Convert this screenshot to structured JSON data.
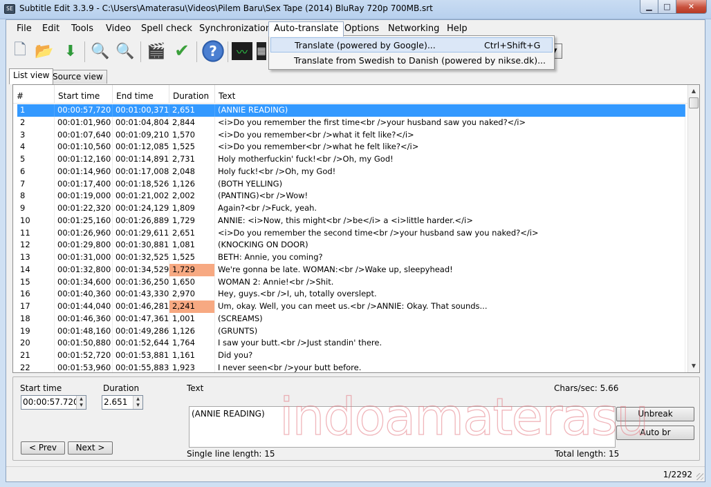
{
  "window": {
    "title": "Subtitle Edit 3.3.9 - C:\\Users\\Amaterasu\\Videos\\Pilem Baru\\Sex Tape (2014) BluRay 720p 700MB.srt",
    "app_icon": "SE",
    "minimize_glyph": "▁",
    "maximize_glyph": "□",
    "close_glyph": "✕"
  },
  "menu": {
    "items": [
      "File",
      "Edit",
      "Tools",
      "Video",
      "Spell check",
      "Synchronization",
      "Auto-translate",
      "Options",
      "Networking",
      "Help"
    ],
    "open_item": "Auto-translate"
  },
  "dropdown": {
    "items": [
      {
        "label": "Translate (powered by Google)...",
        "shortcut": "Ctrl+Shift+G"
      },
      {
        "label": "Translate from Swedish to Danish (powered by nikse.dk)...",
        "shortcut": ""
      }
    ]
  },
  "toolbar": {
    "icons": [
      "new-file-icon",
      "open-folder-icon",
      "download-icon",
      "find-icon",
      "replace-icon",
      "visual-sync-icon",
      "spell-check-icon",
      "help-icon",
      "waveform-icon",
      "video-icon"
    ],
    "glyphs": [
      "🗋",
      "📂",
      "⬇",
      "🔍",
      "🔍",
      "🎬",
      "✔",
      "?",
      "〰",
      "▦"
    ],
    "combo_arrow": "▼"
  },
  "tabs": [
    "List view",
    "Source view"
  ],
  "grid": {
    "columns": [
      "#",
      "Start time",
      "End time",
      "Duration",
      "Text"
    ],
    "rows": [
      {
        "num": "1",
        "start": "00:00:57,720",
        "end": "00:01:00,371",
        "dur": "2,651",
        "text": "(ANNIE READING)",
        "selected": true,
        "warn": false
      },
      {
        "num": "2",
        "start": "00:01:01,960",
        "end": "00:01:04,804",
        "dur": "2,844",
        "text": "<i>Do you remember the first time<br />your husband saw you naked?</i>",
        "selected": false,
        "warn": false
      },
      {
        "num": "3",
        "start": "00:01:07,640",
        "end": "00:01:09,210",
        "dur": "1,570",
        "text": "<i>Do you remember<br />what it felt like?</i>",
        "selected": false,
        "warn": false
      },
      {
        "num": "4",
        "start": "00:01:10,560",
        "end": "00:01:12,085",
        "dur": "1,525",
        "text": "<i>Do you remember<br />what he felt like?</i>",
        "selected": false,
        "warn": false
      },
      {
        "num": "5",
        "start": "00:01:12,160",
        "end": "00:01:14,891",
        "dur": "2,731",
        "text": "Holy motherfuckin' fuck!<br />Oh, my God!",
        "selected": false,
        "warn": false
      },
      {
        "num": "6",
        "start": "00:01:14,960",
        "end": "00:01:17,008",
        "dur": "2,048",
        "text": "Holy fuck!<br />Oh, my God!",
        "selected": false,
        "warn": false
      },
      {
        "num": "7",
        "start": "00:01:17,400",
        "end": "00:01:18,526",
        "dur": "1,126",
        "text": "(BOTH YELLING)",
        "selected": false,
        "warn": false
      },
      {
        "num": "8",
        "start": "00:01:19,000",
        "end": "00:01:21,002",
        "dur": "2,002",
        "text": "(PANTING)<br />Wow!",
        "selected": false,
        "warn": false
      },
      {
        "num": "9",
        "start": "00:01:22,320",
        "end": "00:01:24,129",
        "dur": "1,809",
        "text": "Again?<br />Fuck, yeah.",
        "selected": false,
        "warn": false
      },
      {
        "num": "10",
        "start": "00:01:25,160",
        "end": "00:01:26,889",
        "dur": "1,729",
        "text": "ANNIE: <i>Now, this might<br />be</i> a <i>little harder.</i>",
        "selected": false,
        "warn": false
      },
      {
        "num": "11",
        "start": "00:01:26,960",
        "end": "00:01:29,611",
        "dur": "2,651",
        "text": "<i>Do you remember the second time<br />your husband saw you naked?</i>",
        "selected": false,
        "warn": false
      },
      {
        "num": "12",
        "start": "00:01:29,800",
        "end": "00:01:30,881",
        "dur": "1,081",
        "text": "(KNOCKING ON DOOR)",
        "selected": false,
        "warn": false
      },
      {
        "num": "13",
        "start": "00:01:31,000",
        "end": "00:01:32,525",
        "dur": "1,525",
        "text": "BETH: Annie, you coming?",
        "selected": false,
        "warn": false
      },
      {
        "num": "14",
        "start": "00:01:32,800",
        "end": "00:01:34,529",
        "dur": "1,729",
        "text": "We're gonna be late. WOMAN:<br />Wake up, sleepyhead!",
        "selected": false,
        "warn": true
      },
      {
        "num": "15",
        "start": "00:01:34,600",
        "end": "00:01:36,250",
        "dur": "1,650",
        "text": "WOMAN 2: Annie!<br />Shit.",
        "selected": false,
        "warn": false
      },
      {
        "num": "16",
        "start": "00:01:40,360",
        "end": "00:01:43,330",
        "dur": "2,970",
        "text": "Hey, guys.<br />I, uh, totally overslept.",
        "selected": false,
        "warn": false
      },
      {
        "num": "17",
        "start": "00:01:44,040",
        "end": "00:01:46,281",
        "dur": "2,241",
        "text": "Um, okay. Well, you can meet us.<br />ANNIE: Okay. That sounds...",
        "selected": false,
        "warn": true
      },
      {
        "num": "18",
        "start": "00:01:46,360",
        "end": "00:01:47,361",
        "dur": "1,001",
        "text": "(SCREAMS)",
        "selected": false,
        "warn": false
      },
      {
        "num": "19",
        "start": "00:01:48,160",
        "end": "00:01:49,286",
        "dur": "1,126",
        "text": "(GRUNTS)",
        "selected": false,
        "warn": false
      },
      {
        "num": "20",
        "start": "00:01:50,880",
        "end": "00:01:52,644",
        "dur": "1,764",
        "text": "I saw your butt.<br />Just standin' there.",
        "selected": false,
        "warn": false
      },
      {
        "num": "21",
        "start": "00:01:52,720",
        "end": "00:01:53,881",
        "dur": "1,161",
        "text": "Did you?",
        "selected": false,
        "warn": false
      },
      {
        "num": "22",
        "start": "00:01:53,960",
        "end": "00:01:55,883",
        "dur": "1,923",
        "text": "I never seen<br />your butt before.",
        "selected": false,
        "warn": false
      }
    ],
    "scroll_up": "▲",
    "scroll_down": "▼"
  },
  "editor": {
    "start_time_label": "Start time",
    "start_time_value": "00:00:57.720",
    "duration_label": "Duration",
    "duration_value": "2.651",
    "text_label": "Text",
    "text_value": "(ANNIE READING)",
    "chars_sec": "Chars/sec: 5.66",
    "unbreak": "Unbreak",
    "auto_br": "Auto br",
    "prev": "< Prev",
    "next": "Next >",
    "single_line": "Single line length:  15",
    "total_length": "Total length:  15",
    "spin_up": "▲",
    "spin_down": "▼"
  },
  "watermark": "indoamaterasu",
  "status": {
    "position": "1/2292"
  }
}
